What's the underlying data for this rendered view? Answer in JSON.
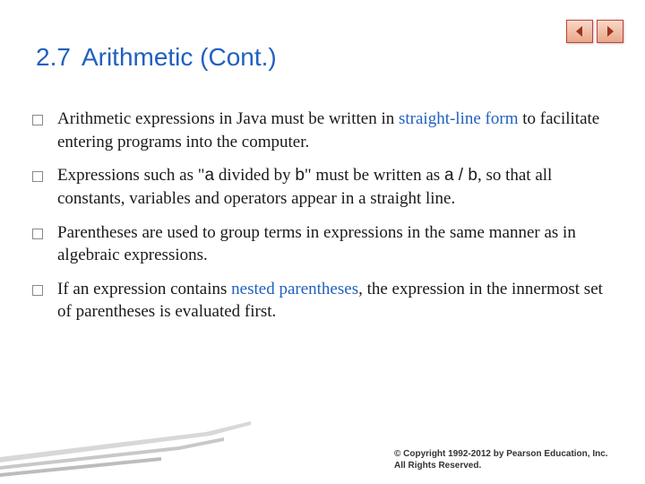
{
  "title": {
    "number": "2.7",
    "text": "Arithmetic (Cont.)"
  },
  "bullets": [
    {
      "pre": "Arithmetic expressions in Java must be written in ",
      "term": "straight-line form",
      "post": " to facilitate entering programs into the computer."
    },
    {
      "pre": "Expressions such as \"",
      "code1": "a",
      "mid1": " divided by ",
      "code2": "b",
      "mid2": "\" must be written as ",
      "code3": "a / b",
      "post": ", so that all constants, variables and operators appear in a straight line."
    },
    {
      "pre": "Parentheses are used to group terms in expressions in the same manner as in algebraic expressions."
    },
    {
      "pre": "If an expression contains ",
      "term": "nested parentheses",
      "post": ", the expression in the innermost set of parentheses is evaluated first."
    }
  ],
  "copyright": "© Copyright 1992-2012 by Pearson Education, Inc. All Rights Reserved."
}
